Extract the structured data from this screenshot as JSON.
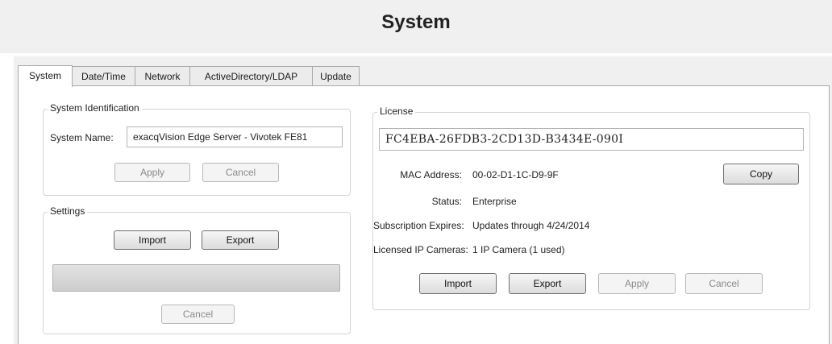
{
  "page": {
    "title": "System"
  },
  "tabs": [
    {
      "label": "System",
      "active": true
    },
    {
      "label": "Date/Time"
    },
    {
      "label": "Network"
    },
    {
      "label": "ActiveDirectory/LDAP"
    },
    {
      "label": "Update"
    }
  ],
  "system_identification": {
    "title": "System Identification",
    "name_label": "System Name:",
    "name_value": "exacqVision Edge Server - Vivotek FE81",
    "apply_label": "Apply",
    "cancel_label": "Cancel"
  },
  "settings": {
    "title": "Settings",
    "import_label": "Import",
    "export_label": "Export",
    "progress": 0,
    "cancel_label": "Cancel"
  },
  "license": {
    "title": "License",
    "key": "FC4EBA-26FDB3-2CD13D-B3434E-090I",
    "mac_label": "MAC Address:",
    "mac_value": "00-02-D1-1C-D9-9F",
    "copy_label": "Copy",
    "status_label": "Status:",
    "status_value": "Enterprise",
    "subscription_label": "Subscription Expires:",
    "subscription_value": "Updates through 4/24/2014",
    "cameras_label": "Licensed IP Cameras:",
    "cameras_value": "1 IP Camera (1 used)",
    "import_label": "Import",
    "export_label": "Export",
    "apply_label": "Apply",
    "cancel_label": "Cancel"
  }
}
